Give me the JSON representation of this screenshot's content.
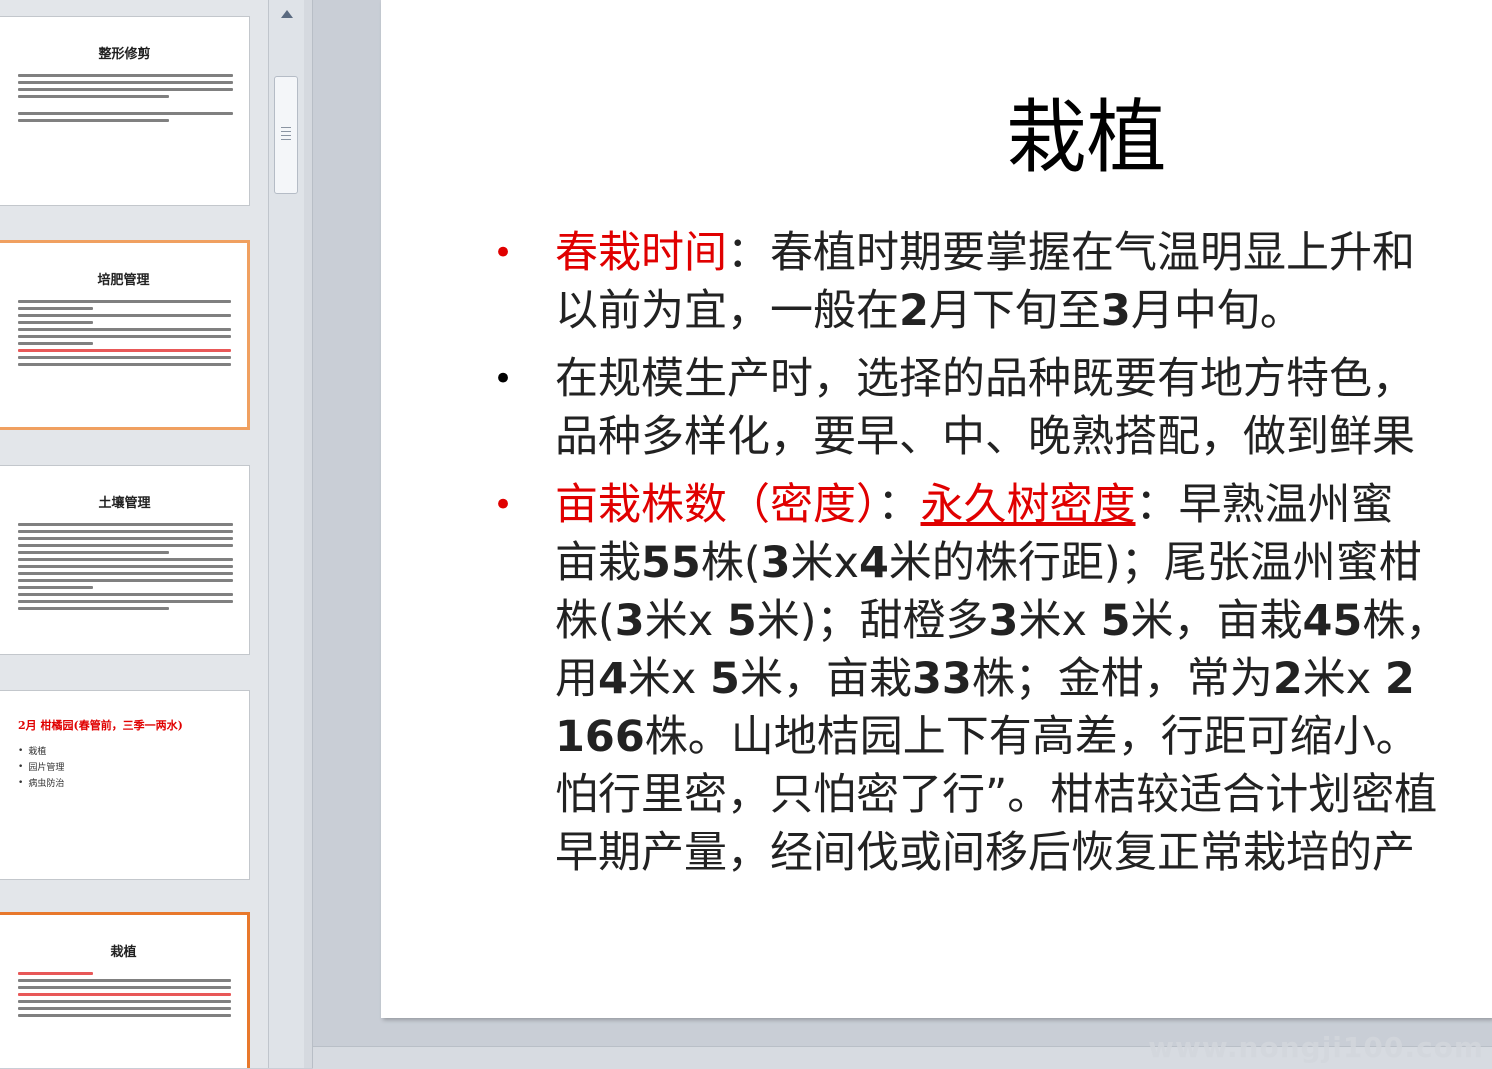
{
  "thumbnails": [
    {
      "title": "整形修剪",
      "style": "normal"
    },
    {
      "title": "培肥管理",
      "style": "selected"
    },
    {
      "title": "土壤管理",
      "style": "normal"
    },
    {
      "title": "2月 柑橘园(春管前，三季一两水)",
      "style": "red-title",
      "bullets": [
        "栽植",
        "园片管理",
        "病虫防治"
      ]
    },
    {
      "title": "栽植",
      "style": "active"
    }
  ],
  "slide": {
    "title": "栽植",
    "bullets": [
      {
        "lines": [
          [
            {
              "t": "春栽时间",
              "c": "red"
            },
            {
              "t": "：春植时期要掌握在气温明显上升和"
            }
          ],
          [
            {
              "t": "以前为宜，一般在"
            },
            {
              "t": "2",
              "b": true
            },
            {
              "t": "月下旬至"
            },
            {
              "t": "3",
              "b": true
            },
            {
              "t": "月中旬。"
            }
          ]
        ]
      },
      {
        "lines": [
          [
            {
              "t": "在规模生产时，选择的品种既要有地方特色，"
            }
          ],
          [
            {
              "t": "品种多样化，要早、中、晚熟搭配，做到鲜果"
            }
          ]
        ]
      },
      {
        "lines": [
          [
            {
              "t": "亩栽株数（密度）",
              "c": "red"
            },
            {
              "t": "："
            },
            {
              "t": "永久树密度",
              "c": "red",
              "u": true
            },
            {
              "t": "：早熟温州蜜"
            }
          ],
          [
            {
              "t": "亩栽"
            },
            {
              "t": "55",
              "b": true
            },
            {
              "t": "株("
            },
            {
              "t": "3",
              "b": true
            },
            {
              "t": "米x"
            },
            {
              "t": "4",
              "b": true
            },
            {
              "t": "米的株行距)；尾张温州蜜柑"
            }
          ],
          [
            {
              "t": "株("
            },
            {
              "t": "3",
              "b": true
            },
            {
              "t": "米x  "
            },
            {
              "t": "5",
              "b": true
            },
            {
              "t": "米)；甜橙多"
            },
            {
              "t": "3",
              "b": true
            },
            {
              "t": "米x  "
            },
            {
              "t": "5",
              "b": true
            },
            {
              "t": "米，亩栽"
            },
            {
              "t": "45",
              "b": true
            },
            {
              "t": "株，"
            }
          ],
          [
            {
              "t": "用"
            },
            {
              "t": "4",
              "b": true
            },
            {
              "t": "米x  "
            },
            {
              "t": "5",
              "b": true
            },
            {
              "t": "米，亩栽"
            },
            {
              "t": "33",
              "b": true
            },
            {
              "t": "株；金柑，常为"
            },
            {
              "t": "2",
              "b": true
            },
            {
              "t": "米x  "
            },
            {
              "t": "2",
              "b": true
            }
          ],
          [
            {
              "t": "166",
              "b": true
            },
            {
              "t": "株。山地桔园上下有高差，行距可缩小。"
            }
          ],
          [
            {
              "t": "怕行里密，只怕密了行”。柑桔较适合计划密植"
            }
          ],
          [
            {
              "t": "早期产量，经间伐或间移后恢复正常栽培的产"
            }
          ]
        ]
      }
    ]
  },
  "watermark": "www.nongji100.com",
  "colors": {
    "accent_red": "#e00000",
    "selected_border": "#e8782c"
  },
  "icons": {
    "scroll_up": "triangle-up-icon"
  }
}
